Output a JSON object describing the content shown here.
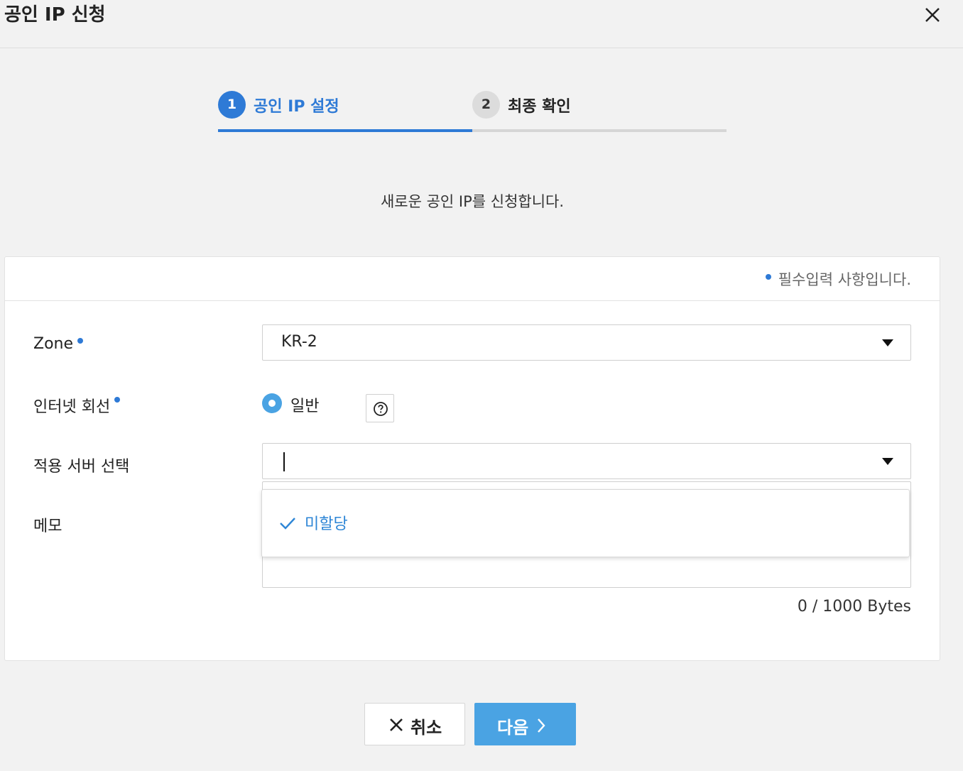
{
  "dialog": {
    "title": "공인 IP 신청"
  },
  "steps": [
    {
      "number": "1",
      "label": "공인 IP 설정",
      "state": "active"
    },
    {
      "number": "2",
      "label": "최종 확인",
      "state": "inactive"
    }
  ],
  "intro_text": "새로운 공인 IP를 신청합니다.",
  "form": {
    "required_note": "필수입력 사항입니다.",
    "zone": {
      "label": "Zone",
      "value": "KR-2"
    },
    "internet_line": {
      "label": "인터넷 회선",
      "option_label": "일반",
      "selected": true
    },
    "server_select": {
      "label": "적용 서버 선택",
      "value": "",
      "options": [
        "미할당"
      ],
      "selected_option": "미할당"
    },
    "memo": {
      "label": "메모",
      "value": "",
      "byte_counter": "0 / 1000 Bytes"
    }
  },
  "buttons": {
    "cancel_label": "취소",
    "next_label": "다음"
  },
  "colors": {
    "accent": "#2e7ad6",
    "button_primary": "#4aa3e3",
    "dropdown_option": "#2e86d6"
  }
}
